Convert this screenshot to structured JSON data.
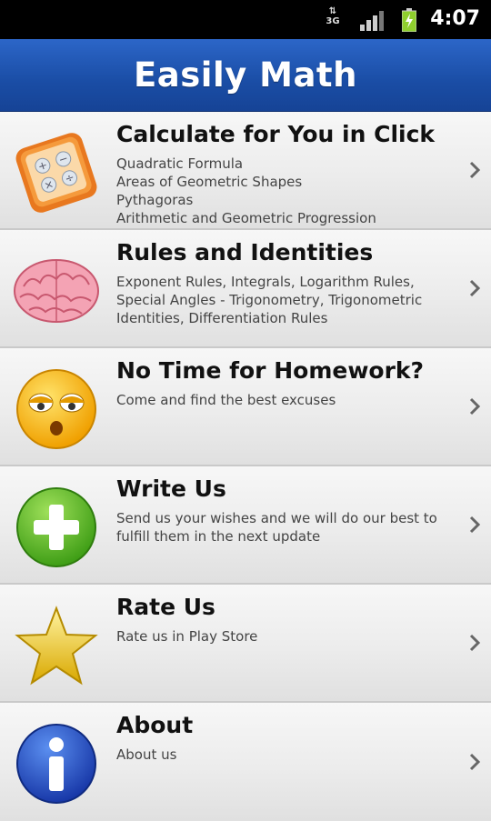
{
  "status_bar": {
    "network": "3G",
    "time": "4:07",
    "icons": [
      "data-transfer-icon",
      "signal-icon",
      "battery-icon"
    ]
  },
  "app_bar": {
    "title": "Easily Math"
  },
  "menu": [
    {
      "title": "Calculate for You in Click",
      "description": "Quadratic Formula\nAreas of Geometric Shapes\nPythagoras\nArithmetic and Geometric Progression",
      "icon": "calculator-icon"
    },
    {
      "title": "Rules and Identities",
      "description": "Exponent Rules, Integrals, Logarithm Rules, Special Angles - Trigonometry, Trigonometric Identities, Differentiation Rules",
      "icon": "brain-icon"
    },
    {
      "title": "No Time for Homework?",
      "description": "Come and find the best excuses",
      "icon": "sleepy-face-icon"
    },
    {
      "title": "Write Us",
      "description": "Send us your wishes and we will do our best to fulfill them in the next update",
      "icon": "plus-circle-icon"
    },
    {
      "title": "Rate Us",
      "description": "Rate us in Play Store",
      "icon": "star-icon"
    },
    {
      "title": "About",
      "description": "About us",
      "icon": "info-icon"
    }
  ],
  "colors": {
    "app_bar": "#1a4da5",
    "row_background": "#ececec",
    "title_text": "#111111",
    "description_text": "#444444"
  }
}
